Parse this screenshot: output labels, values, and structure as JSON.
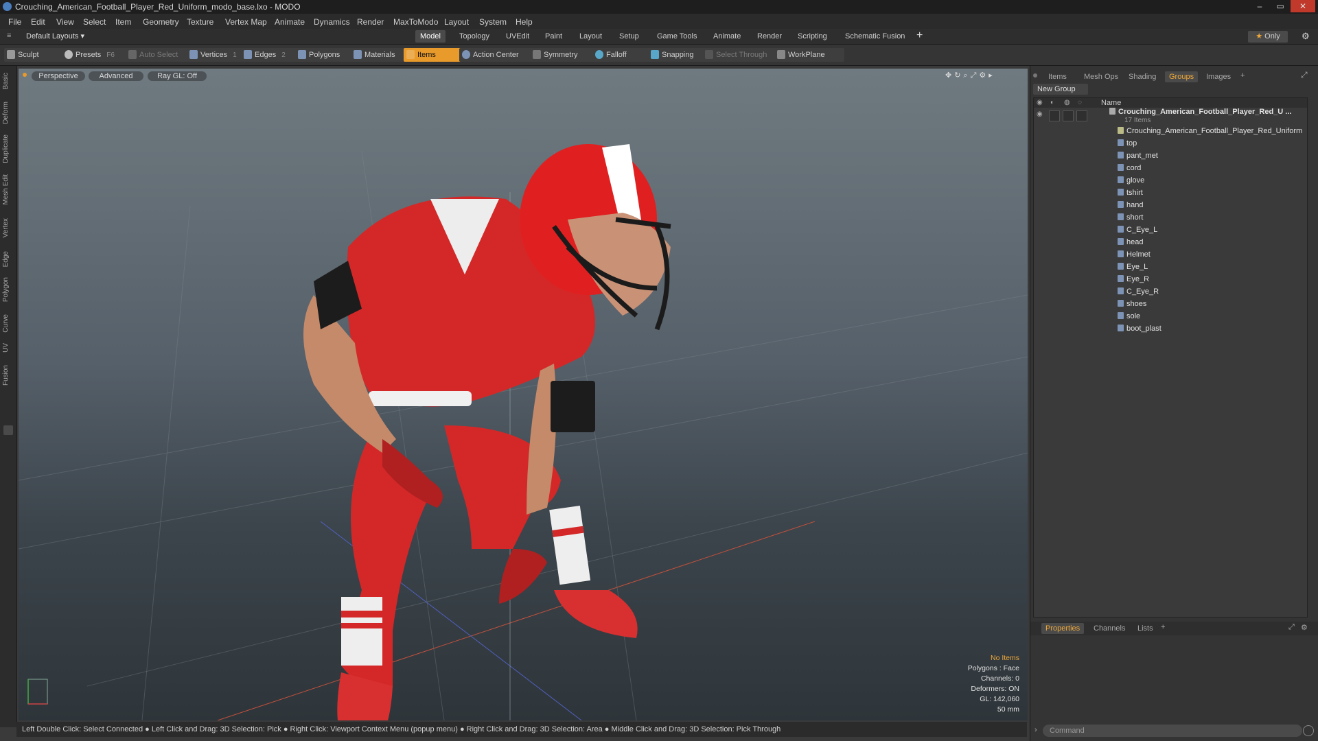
{
  "window": {
    "title": "Crouching_American_Football_Player_Red_Uniform_modo_base.lxo - MODO"
  },
  "menu": [
    "File",
    "Edit",
    "View",
    "Select",
    "Item",
    "Geometry",
    "Texture",
    "Vertex Map",
    "Animate",
    "Dynamics",
    "Render",
    "MaxToModo",
    "Layout",
    "System",
    "Help"
  ],
  "layouts": {
    "current": "Default Layouts",
    "tabs": [
      "Model",
      "Topology",
      "UVEdit",
      "Paint",
      "Layout",
      "Setup",
      "Game Tools",
      "Animate",
      "Render",
      "Scripting",
      "Schematic Fusion"
    ],
    "active_tab": "Model",
    "only_label": "Only"
  },
  "toolbar": {
    "sculpt": "Sculpt",
    "presets": "Presets",
    "presets_key": "F6",
    "auto_select": "Auto Select",
    "vertices": "Vertices",
    "vertices_count": "1",
    "edges": "Edges",
    "edges_count": "2",
    "polygons": "Polygons",
    "materials": "Materials",
    "items": "Items",
    "action_center": "Action Center",
    "symmetry": "Symmetry",
    "falloff": "Falloff",
    "snapping": "Snapping",
    "select_through": "Select Through",
    "workplane": "WorkPlane"
  },
  "left_tabs": [
    "Basic",
    "Deform",
    "Duplicate",
    "Mesh Edit",
    "Vertex",
    "Edge",
    "Polygon",
    "Curve",
    "UV",
    "Fusion"
  ],
  "viewport": {
    "perspective": "Perspective",
    "advanced": "Advanced",
    "raygl": "Ray GL: Off",
    "info": {
      "no_items": "No Items",
      "polygons": "Polygons : Face",
      "channels": "Channels: 0",
      "deformers": "Deformers: ON",
      "gl": "GL: 142,060",
      "focal": "50 mm"
    }
  },
  "status": "Left Double Click: Select Connected ● Left Click and Drag: 3D Selection: Pick ● Right Click: Viewport Context Menu (popup menu) ● Right Click and Drag: 3D Selection: Area ● Middle Click and Drag: 3D Selection: Pick Through",
  "right_panel": {
    "tabs": [
      "Items",
      "Mesh Ops",
      "Shading",
      "Groups",
      "Images"
    ],
    "active_tab": "Groups",
    "new_group": "New Group",
    "name_header": "Name",
    "group_name": "Crouching_American_Football_Player_Red_U ...",
    "item_count": "17 Items",
    "items": [
      "Crouching_American_Football_Player_Red_Uniform",
      "top",
      "pant_met",
      "cord",
      "glove",
      "tshirt",
      "hand",
      "short",
      "C_Eye_L",
      "head",
      "Helmet",
      "Eye_L",
      "Eye_R",
      "C_Eye_R",
      "shoes",
      "sole",
      "boot_plast"
    ]
  },
  "bottom_panel": {
    "tabs": [
      "Properties",
      "Channels",
      "Lists"
    ],
    "active_tab": "Properties",
    "command_placeholder": "Command"
  },
  "colors": {
    "accent": "#e89a2a",
    "jersey": "#d42828",
    "helmet": "#e02020"
  }
}
